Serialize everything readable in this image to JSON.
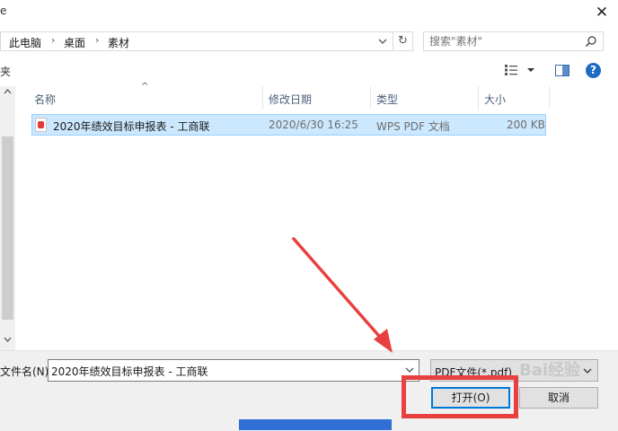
{
  "window": {
    "left_stub": "e",
    "close_label": "✕"
  },
  "address": {
    "crumbs": [
      "此电脑",
      "桌面",
      "素材"
    ],
    "separator": "›",
    "refresh_label": "↻"
  },
  "search": {
    "placeholder": "搜索\"素材\""
  },
  "toolbar": {
    "left_stub": "夹",
    "help_label": "?"
  },
  "columns": [
    "名称",
    "修改日期",
    "类型",
    "大小"
  ],
  "files": [
    {
      "name": "2020年绩效目标申报表 - 工商联",
      "modified": "2020/6/30 16:25",
      "type": "WPS PDF 文档",
      "size": "200 KB",
      "icon": "pdf-file-icon",
      "selected": true
    }
  ],
  "bottom": {
    "filename_label": "文件名(N):",
    "filename_value": "2020年绩效目标申报表 - 工商联",
    "filetype_value": "PDF文件(*.pdf)",
    "open_label": "打开(O)",
    "cancel_label": "取消"
  },
  "colors": {
    "selection": "#cce8ff",
    "annotation_red": "#e8403f",
    "accent_blue": "#0078d7"
  },
  "watermark": "Bai经验"
}
